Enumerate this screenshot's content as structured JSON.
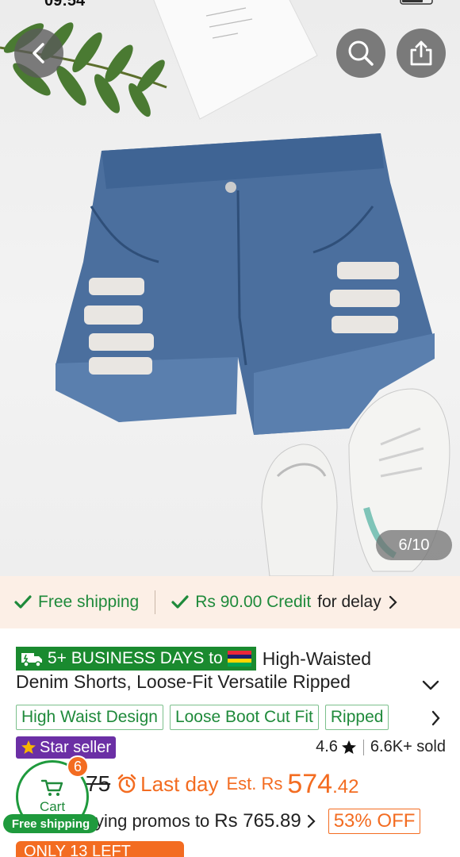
{
  "status_bar": {
    "time": "09:54"
  },
  "gallery": {
    "counter": "6/10"
  },
  "shipping_strip": {
    "free_shipping": "Free shipping",
    "credit": "Rs 90.00 Credit",
    "delay": "for delay"
  },
  "product": {
    "delivery_badge": "5+ BUSINESS DAYS to",
    "title_line1": "High-Waisted",
    "title_line2": "Denim Shorts, Loose-Fit Versatile Ripped",
    "tags": [
      "High Waist Design",
      "Loose Boot Cut Fit",
      "Ripped"
    ],
    "seller_badge": "Star seller",
    "rating": "4.6",
    "sold": "6.6K+ sold",
    "old_price": "75",
    "last_day": "Last day",
    "est_label": "Est. Rs",
    "est_price_main": "574",
    "est_price_decimal": ".42",
    "promo_text": "ying promos to",
    "promo_price": "Rs 765.89",
    "discount": "53% OFF",
    "stock": "ONLY 13 LEFT"
  },
  "cart": {
    "label": "Cart",
    "count": "6",
    "free_shipping": "Free shipping"
  },
  "colors": {
    "green": "#1f8a3b",
    "orange": "#f36c21",
    "purple": "#6b2fa5",
    "strip_bg": "#fcefe6"
  }
}
